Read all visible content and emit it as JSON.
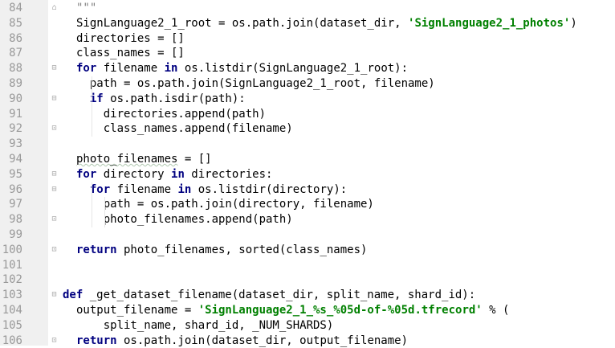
{
  "editor": {
    "lines": [
      {
        "num": "84",
        "tokens": [
          {
            "t": "\"\"\"",
            "c": "doc"
          }
        ]
      },
      {
        "num": "85",
        "tokens": [
          {
            "t": "SignLanguage2_1_root = os.path.join(dataset_dir, ",
            "c": ""
          },
          {
            "t": "'SignLanguage2_1_photos'",
            "c": "str"
          },
          {
            "t": ")",
            "c": ""
          }
        ]
      },
      {
        "num": "86",
        "tokens": [
          {
            "t": "directories = []",
            "c": ""
          }
        ]
      },
      {
        "num": "87",
        "tokens": [
          {
            "t": "class_names = []",
            "c": ""
          }
        ]
      },
      {
        "num": "88",
        "tokens": [
          {
            "t": "for",
            "c": "kw"
          },
          {
            "t": " filename ",
            "c": ""
          },
          {
            "t": "in",
            "c": "kw"
          },
          {
            "t": " os.listdir(SignLanguage2_1_root):",
            "c": ""
          }
        ]
      },
      {
        "num": "89",
        "tokens": [
          {
            "t": "  path = os.path.join(SignLanguage2_1_root, filename)",
            "c": ""
          }
        ]
      },
      {
        "num": "90",
        "tokens": [
          {
            "t": "  ",
            "c": ""
          },
          {
            "t": "if",
            "c": "kw"
          },
          {
            "t": " os.path.isdir(path):",
            "c": ""
          }
        ]
      },
      {
        "num": "91",
        "tokens": [
          {
            "t": "    directories.append(path)",
            "c": ""
          }
        ]
      },
      {
        "num": "92",
        "tokens": [
          {
            "t": "    class_names.append(filename)",
            "c": ""
          }
        ]
      },
      {
        "num": "93",
        "tokens": []
      },
      {
        "num": "94",
        "tokens": [
          {
            "t": "photo_filenames",
            "c": "squig"
          },
          {
            "t": " = []",
            "c": ""
          }
        ]
      },
      {
        "num": "95",
        "tokens": [
          {
            "t": "for",
            "c": "kw"
          },
          {
            "t": " directory ",
            "c": ""
          },
          {
            "t": "in",
            "c": "kw"
          },
          {
            "t": " directories:",
            "c": ""
          }
        ]
      },
      {
        "num": "96",
        "tokens": [
          {
            "t": "  ",
            "c": ""
          },
          {
            "t": "for",
            "c": "kw"
          },
          {
            "t": " filename ",
            "c": ""
          },
          {
            "t": "in",
            "c": "kw"
          },
          {
            "t": " os.listdir(directory):",
            "c": ""
          }
        ]
      },
      {
        "num": "97",
        "tokens": [
          {
            "t": "    path = os.path.join(directory, filename)",
            "c": ""
          }
        ]
      },
      {
        "num": "98",
        "tokens": [
          {
            "t": "    photo_filenames.append(path)",
            "c": ""
          }
        ]
      },
      {
        "num": "99",
        "tokens": []
      },
      {
        "num": "100",
        "tokens": [
          {
            "t": "return",
            "c": "kw"
          },
          {
            "t": " photo_filenames, sorted(class_names)",
            "c": ""
          }
        ]
      },
      {
        "num": "101",
        "tokens": []
      },
      {
        "num": "102",
        "tokens": []
      },
      {
        "num": "103",
        "tokens": [
          {
            "t": "def",
            "c": "kw"
          },
          {
            "t": " _get_dataset_filename(dataset_dir, split_name, shard_id):",
            "c": ""
          }
        ]
      },
      {
        "num": "104",
        "tokens": [
          {
            "t": "output_filename = ",
            "c": ""
          },
          {
            "t": "'SignLanguage2_1_%s_%05d-of-%05d.tfrecord'",
            "c": "str"
          },
          {
            "t": " % (",
            "c": ""
          }
        ]
      },
      {
        "num": "105",
        "tokens": [
          {
            "t": "    split_name, shard_id, _NUM_SHARDS)",
            "c": ""
          }
        ]
      },
      {
        "num": "106",
        "tokens": [
          {
            "t": "return",
            "c": "kw"
          },
          {
            "t": " os.path.join(dataset_dir, output_filename)",
            "c": ""
          }
        ]
      }
    ],
    "indents": [
      1,
      1,
      1,
      1,
      1,
      1,
      1,
      1,
      1,
      1,
      1,
      1,
      1,
      1,
      1,
      1,
      1,
      1,
      1,
      0,
      1,
      1,
      1
    ],
    "folds": {
      "84": "⌂",
      "88": "▽",
      "90": "▽",
      "92": "△",
      "95": "▽",
      "96": "▽",
      "98": "△",
      "100": "△",
      "103": "▽",
      "106": "△"
    }
  }
}
